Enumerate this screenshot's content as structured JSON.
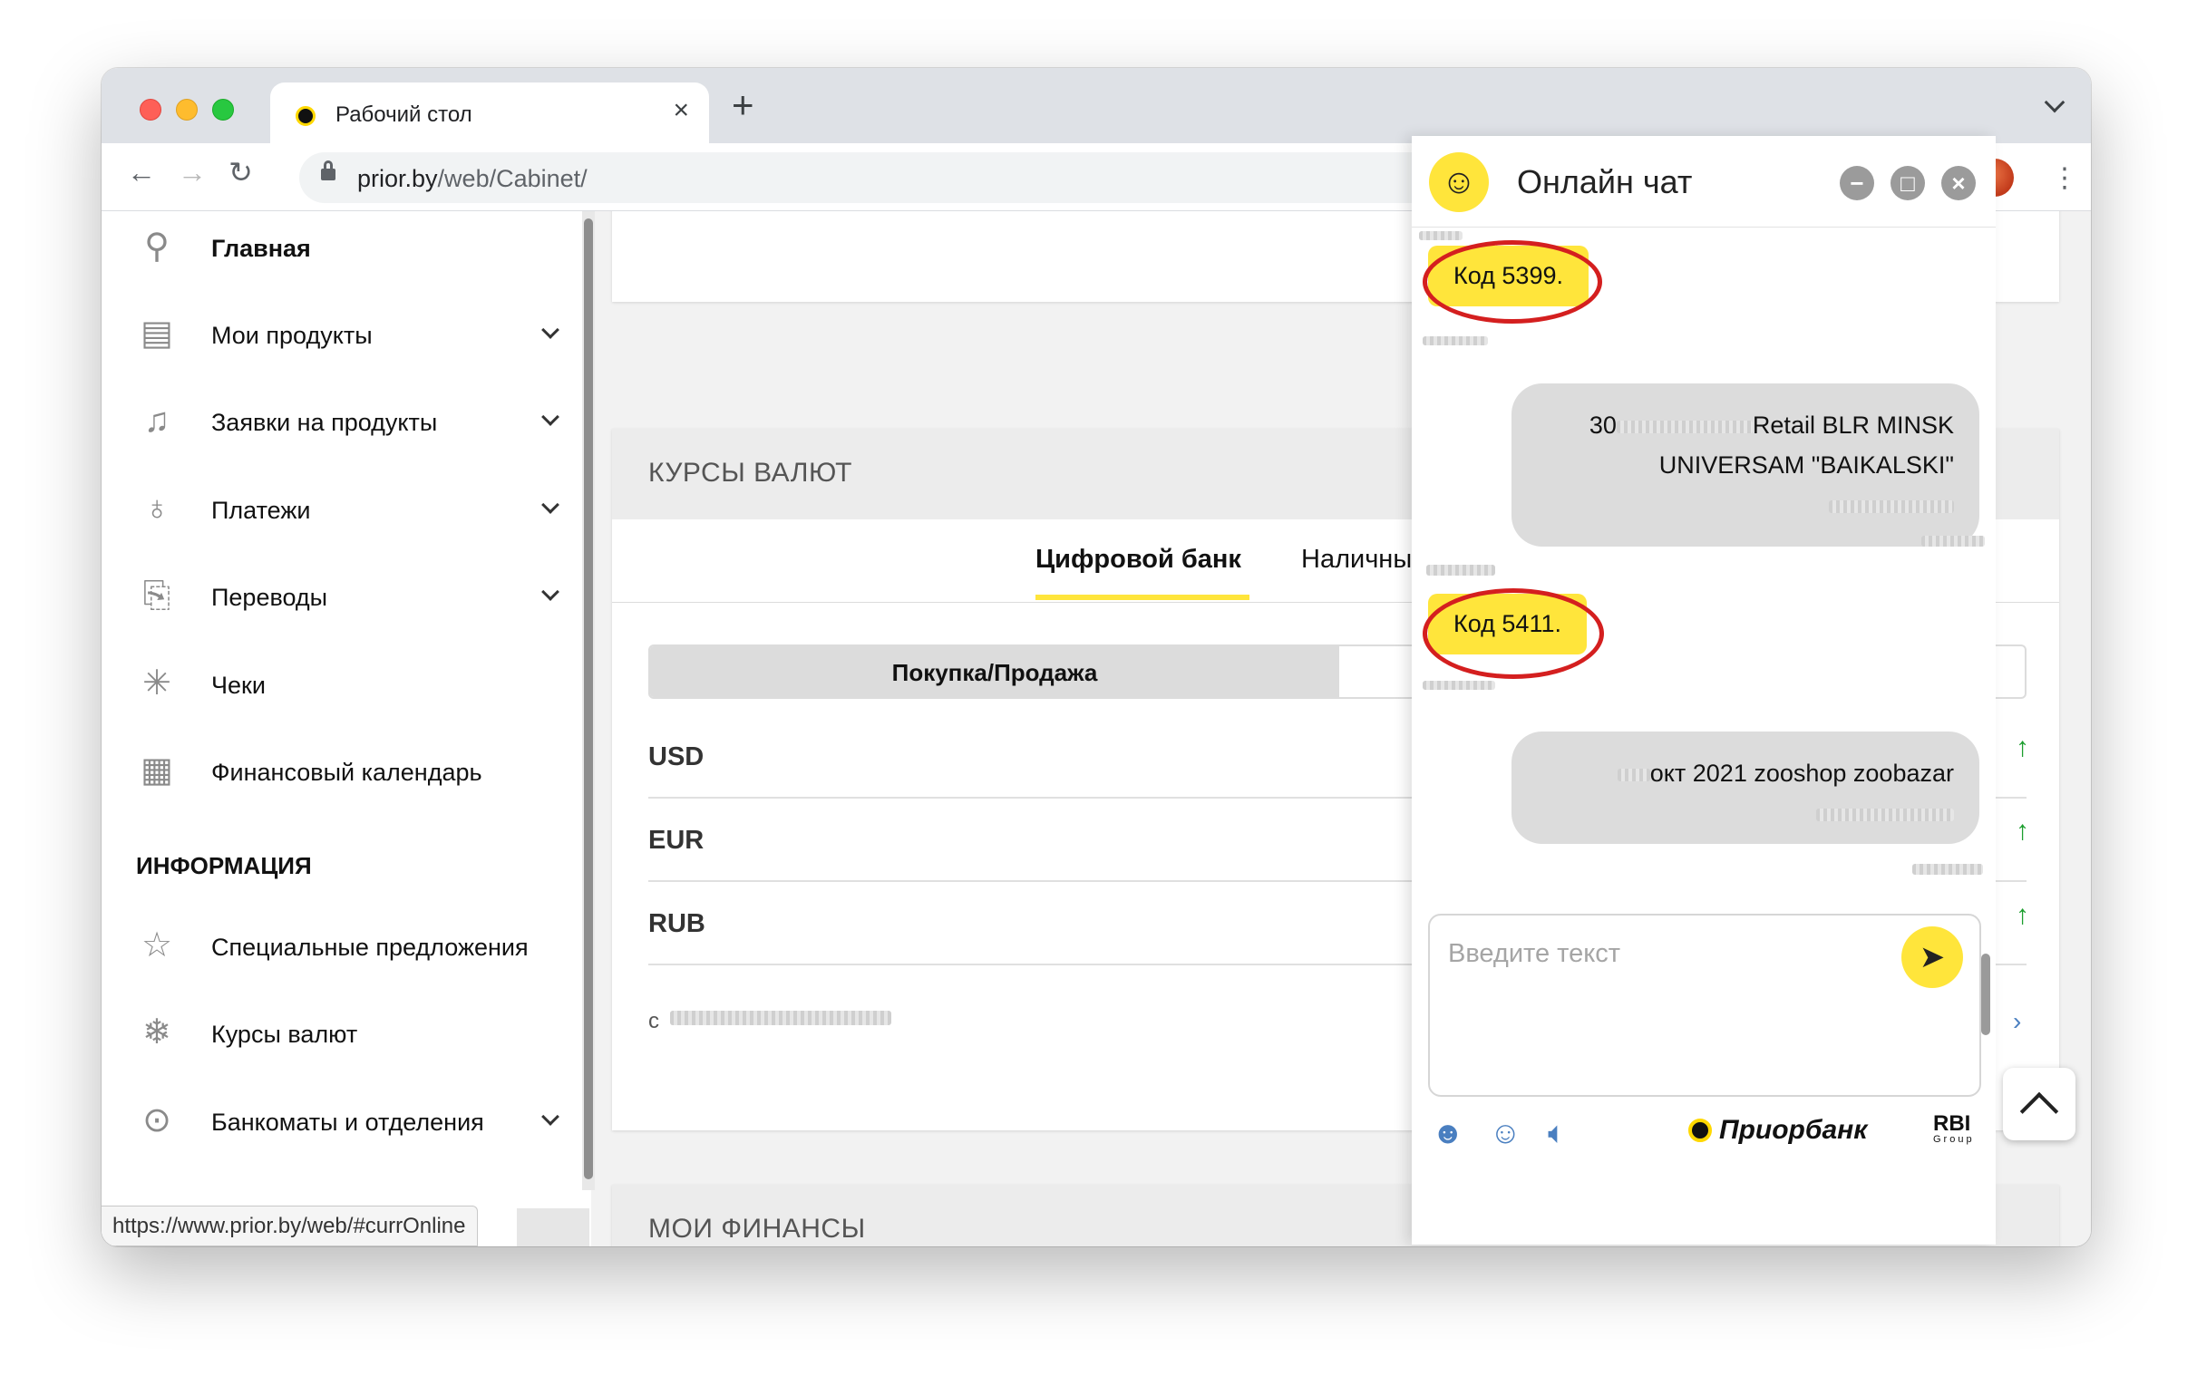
{
  "browser": {
    "tab_title": "Рабочий стол",
    "url_host": "prior.by",
    "url_path": "/web/Cabinet/",
    "status_url": "https://www.prior.by/web/#currOnline"
  },
  "sidebar": {
    "items": [
      {
        "label": "Главная",
        "icon": "tree-icon"
      },
      {
        "label": "Мои продукты",
        "icon": "card-icon"
      },
      {
        "label": "Заявки на продукты",
        "icon": "bell-icon"
      },
      {
        "label": "Платежи",
        "icon": "bag-icon"
      },
      {
        "label": "Переводы",
        "icon": "transfer-icon"
      },
      {
        "label": "Чеки",
        "icon": "receipt-icon"
      },
      {
        "label": "Финансовый календарь",
        "icon": "calendar-icon"
      }
    ],
    "info_heading": "ИНФОРМАЦИЯ",
    "info_items": [
      {
        "label": "Специальные предложения",
        "icon": "star-icon"
      },
      {
        "label": "Курсы валют",
        "icon": "snowflake-icon"
      },
      {
        "label": "Банкоматы и отделения",
        "icon": "location-pin-icon"
      }
    ]
  },
  "rates": {
    "title": "КУРСЫ ВАЛЮТ",
    "tabs": [
      "Цифровой банк",
      "Наличны"
    ],
    "segment": "Покупка/Продажа",
    "currencies": [
      "USD",
      "EUR",
      "RUB"
    ],
    "footer_prefix": "с"
  },
  "finances": {
    "title": "МОИ ФИНАНСЫ"
  },
  "chat": {
    "title": "Онлайн чат",
    "code1": "Код 5399.",
    "msg1_line1": "30",
    "msg1_line1_tail": "Retail BLR MINSK",
    "msg1_line2": "UNIVERSAM \"BAIKALSKI\"",
    "code2": "Код 5411.",
    "msg2_line1": "окт 2021 zooshop zoobazar",
    "input_placeholder": "Введите текст",
    "brand": "Приорбанк",
    "group": "RBI",
    "group_sub": "Group"
  },
  "colors": {
    "accent": "#ffe53b",
    "rate_up": "#1c9e2e",
    "highlight_ring": "#d41f1f"
  }
}
